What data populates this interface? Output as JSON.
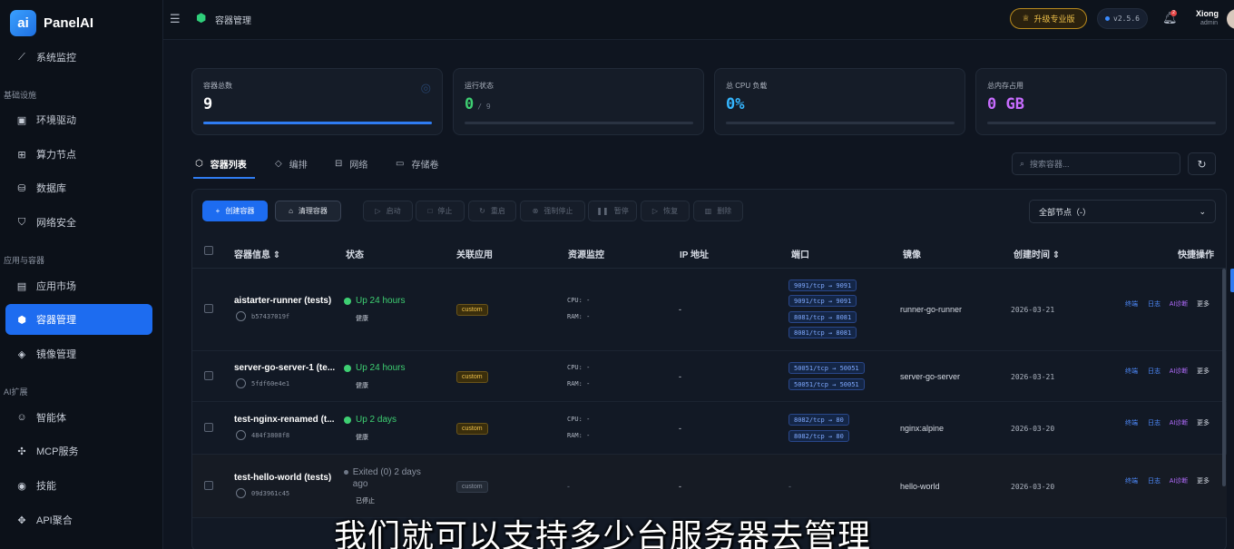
{
  "app": {
    "logo_mark": "ai",
    "name": "PanelAI"
  },
  "sidebar": {
    "items": [
      {
        "label": "系统监控",
        "icon": "chart-line-icon"
      },
      {
        "label": "环境驱动",
        "icon": "grid-icon"
      },
      {
        "label": "算力节点",
        "icon": "chip-icon"
      },
      {
        "label": "数据库",
        "icon": "database-icon"
      },
      {
        "label": "网络安全",
        "icon": "shield-icon"
      },
      {
        "label": "应用市场",
        "icon": "store-icon"
      },
      {
        "label": "容器管理",
        "icon": "cube-icon",
        "active": true
      },
      {
        "label": "镜像管理",
        "icon": "layers-icon"
      },
      {
        "label": "智能体",
        "icon": "robot-icon"
      },
      {
        "label": "MCP服务",
        "icon": "network-icon"
      },
      {
        "label": "技能",
        "icon": "skill-icon"
      },
      {
        "label": "API聚合",
        "icon": "api-icon"
      }
    ],
    "sections": [
      "基础设施",
      "应用与容器",
      "AI扩展"
    ]
  },
  "topbar": {
    "page_title": "容器管理",
    "upgrade_label": "升级专业版",
    "version": "v2.5.6",
    "notification_count": "2",
    "user_name": "Xiong",
    "user_role": "admin"
  },
  "stats": [
    {
      "label": "容器总数",
      "value": "9",
      "sub": "",
      "color": "#ffffff",
      "bar": 1.0
    },
    {
      "label": "运行状态",
      "value": "0",
      "sub": "/ 9",
      "color": "#3ecf72",
      "bar": 0
    },
    {
      "label": "总 CPU 负载",
      "value": "0%",
      "sub": "",
      "color": "#35b6ff",
      "bar": 0
    },
    {
      "label": "总内存占用",
      "value": "0 GB",
      "sub": "",
      "color": "#c86cff",
      "bar": 0
    }
  ],
  "tabs": [
    {
      "label": "容器列表",
      "icon": "cube-icon"
    },
    {
      "label": "编排",
      "icon": "layers-icon"
    },
    {
      "label": "网络",
      "icon": "network-icon"
    },
    {
      "label": "存储卷",
      "icon": "hdd-icon"
    }
  ],
  "search": {
    "placeholder": "搜索容器..."
  },
  "toolbar": {
    "create": "创建容器",
    "clean": "清理容器",
    "start": "启动",
    "stop": "停止",
    "restart": "重启",
    "force_stop": "强制停止",
    "pause": "暂停",
    "resume": "恢复",
    "delete": "删除",
    "node_filter": "全部节点（-）"
  },
  "table": {
    "headers": [
      "容器信息",
      "状态",
      "关联应用",
      "资源监控",
      "IP 地址",
      "端口",
      "镜像",
      "创建时间",
      "快捷操作"
    ],
    "quick_actions": [
      "终端",
      "日志",
      "AI诊断",
      "更多"
    ],
    "cpu_label": "CPU: -",
    "ram_label": "RAM: -",
    "rows": [
      {
        "name": "aistarter-runner (tests)",
        "id": "b57437019f",
        "status": "Up 24 hours",
        "health": "健康",
        "app": "custom",
        "ip": "-",
        "ports": [
          "9091/tcp → 9091",
          "9091/tcp → 9091",
          "8081/tcp → 8081",
          "8081/tcp → 8081"
        ],
        "image": "runner-go-runner",
        "created": "2026-03-21"
      },
      {
        "name": "server-go-server-1 (te...",
        "id": "5fdf60e4e1",
        "status": "Up 24 hours",
        "health": "健康",
        "app": "custom",
        "ip": "-",
        "ports": [
          "50051/tcp → 50051",
          "50051/tcp → 50051"
        ],
        "image": "server-go-server",
        "created": "2026-03-21"
      },
      {
        "name": "test-nginx-renamed (t...",
        "id": "484f3808f8",
        "status": "Up 2 days",
        "health": "健康",
        "app": "custom",
        "ip": "-",
        "ports": [
          "8082/tcp → 80",
          "8082/tcp → 80"
        ],
        "image": "nginx:alpine",
        "created": "2026-03-20"
      },
      {
        "name": "test-hello-world (tests)",
        "id": "09d3961c45",
        "status": "Exited (0) 2 days ago",
        "health": "已停止",
        "app": "custom",
        "resource": "-",
        "ip": "-",
        "port": "-",
        "image": "hello-world",
        "created": "2026-03-20"
      }
    ]
  },
  "caption": "我们就可以支持多少台服务器去管理"
}
